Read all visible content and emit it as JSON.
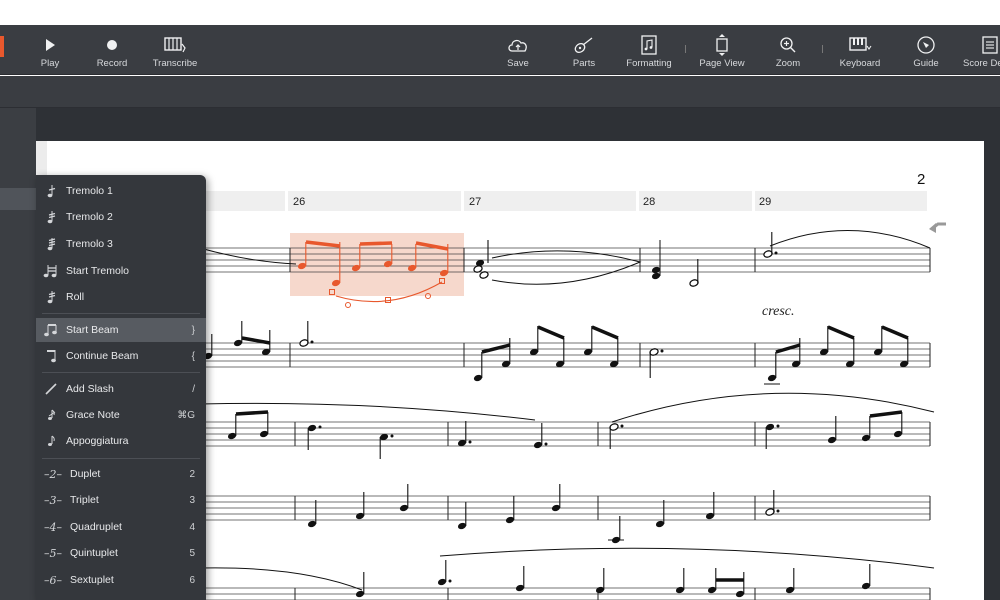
{
  "toolbar": {
    "play": "Play",
    "record": "Record",
    "transcribe": "Transcribe",
    "save": "Save",
    "parts": "Parts",
    "formatting": "Formatting",
    "page_view": "Page View",
    "zoom": "Zoom",
    "keyboard": "Keyboard",
    "guide": "Guide",
    "score_details": "Score De"
  },
  "score": {
    "page_number": "2",
    "measures": [
      "26",
      "27",
      "28",
      "29"
    ],
    "dynamic": "cresc."
  },
  "menu": {
    "items": [
      {
        "label": "Tremolo 1",
        "key": ""
      },
      {
        "label": "Tremolo 2",
        "key": ""
      },
      {
        "label": "Tremolo 3",
        "key": ""
      },
      {
        "label": "Start Tremolo",
        "key": ""
      },
      {
        "label": "Roll",
        "key": ""
      },
      {
        "label": "Start Beam",
        "key": "}"
      },
      {
        "label": "Continue Beam",
        "key": "{"
      },
      {
        "label": "Add Slash",
        "key": "/"
      },
      {
        "label": "Grace Note",
        "key": "⌘G"
      },
      {
        "label": "Appoggiatura",
        "key": ""
      },
      {
        "label": "Duplet",
        "key": "2",
        "tuplet": "2"
      },
      {
        "label": "Triplet",
        "key": "3",
        "tuplet": "3"
      },
      {
        "label": "Quadruplet",
        "key": "4",
        "tuplet": "4"
      },
      {
        "label": "Quintuplet",
        "key": "5",
        "tuplet": "5"
      },
      {
        "label": "Sextuplet",
        "key": "6",
        "tuplet": "6"
      }
    ]
  },
  "colors": {
    "accent": "#e8582d",
    "toolbar_bg": "#3a3d42",
    "menu_bg": "#34373c",
    "selection_fill": "#f6d8cc"
  }
}
